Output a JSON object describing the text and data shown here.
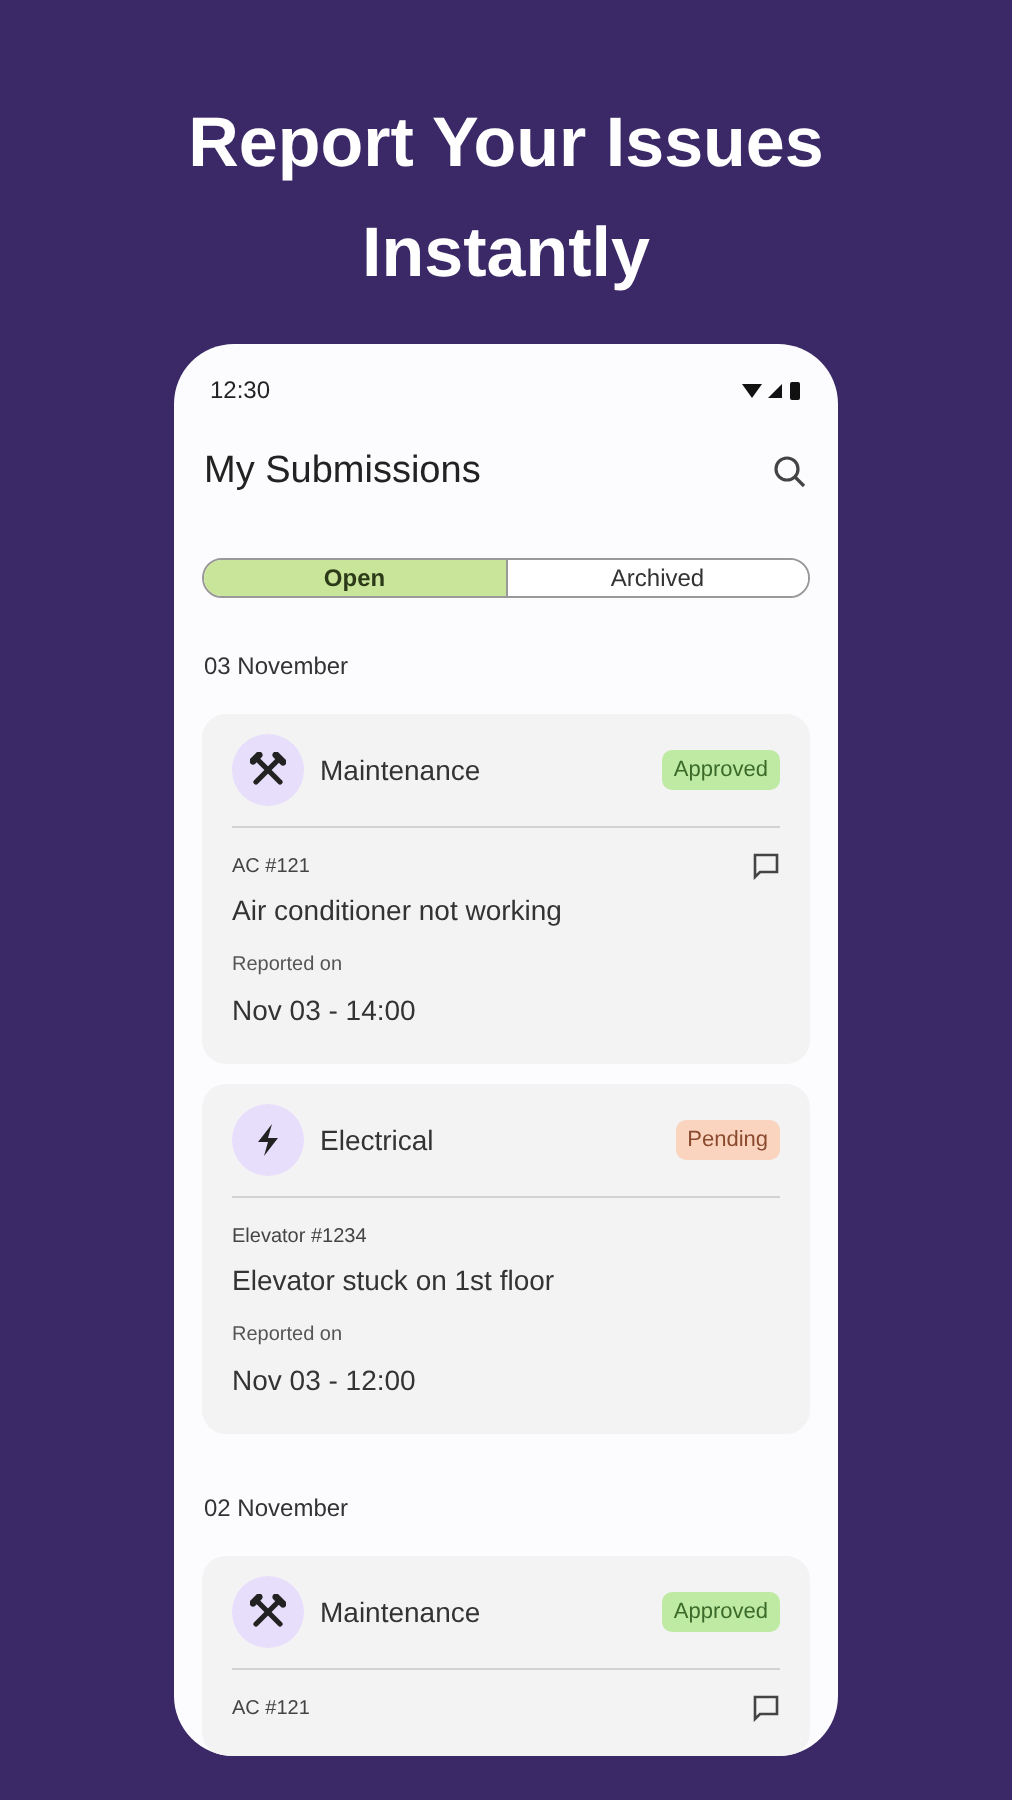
{
  "headline": "Report Your Issues Instantly",
  "status_bar": {
    "time": "12:30"
  },
  "app_bar": {
    "title": "My Submissions"
  },
  "tabs": [
    {
      "label": "Open",
      "selected": true
    },
    {
      "label": "Archived",
      "selected": false
    }
  ],
  "groups": [
    {
      "date": "03 November",
      "cards": [
        {
          "category": "Maintenance",
          "kind": "tools",
          "status": {
            "label": "Approved",
            "kind": "approved"
          },
          "asset": "AC #121",
          "title": "Air conditioner not working",
          "reported_label": "Reported on",
          "reported": "Nov 03 - 14:00",
          "has_comment": true
        },
        {
          "category": "Electrical",
          "kind": "bolt",
          "status": {
            "label": "Pending",
            "kind": "pending"
          },
          "asset": "Elevator #1234",
          "title": "Elevator stuck on 1st floor",
          "reported_label": "Reported on",
          "reported": "Nov 03 - 12:00",
          "has_comment": false
        }
      ]
    },
    {
      "date": "02 November",
      "cards": [
        {
          "category": "Maintenance",
          "kind": "tools",
          "status": {
            "label": "Approved",
            "kind": "approved"
          },
          "asset": "AC #121",
          "has_comment": true
        }
      ]
    }
  ]
}
